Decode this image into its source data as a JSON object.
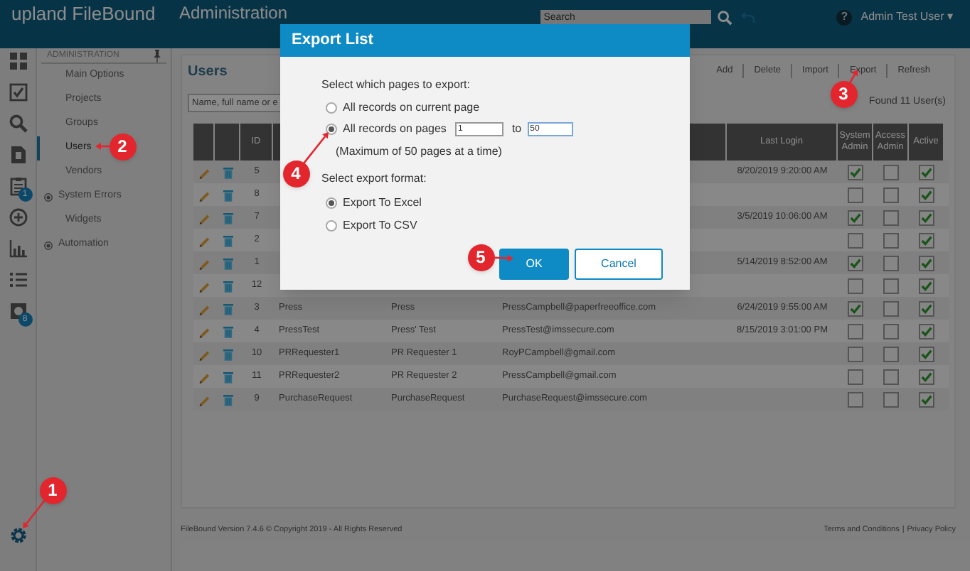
{
  "header": {
    "logo": "upland FileBound",
    "title": "Administration",
    "search": {
      "placeholder": "Search"
    },
    "help": "?",
    "user": "Admin Test User",
    "user_caret": "▾"
  },
  "rail": [
    {
      "kind": "dashboard"
    },
    {
      "kind": "task"
    },
    {
      "kind": "search"
    },
    {
      "kind": "document"
    },
    {
      "kind": "clipboard",
      "badge": "1"
    },
    {
      "kind": "plus"
    },
    {
      "kind": "chart"
    },
    {
      "kind": "list"
    },
    {
      "kind": "box",
      "badge": "8"
    },
    {
      "kind": "settings"
    }
  ],
  "sidebar": {
    "heading": "ADMINISTRATION",
    "items": [
      {
        "label": "Main Options",
        "kind": "item",
        "selected": false
      },
      {
        "label": "Projects",
        "kind": "item",
        "selected": false
      },
      {
        "label": "Groups",
        "kind": "item",
        "selected": false
      },
      {
        "label": "Users",
        "kind": "item",
        "selected": true
      },
      {
        "label": "Vendors",
        "kind": "item",
        "selected": false
      },
      {
        "label": "System Errors",
        "kind": "group",
        "selected": false
      },
      {
        "label": "Widgets",
        "kind": "item",
        "selected": false
      },
      {
        "label": "Automation",
        "kind": "group",
        "selected": false
      }
    ]
  },
  "users": {
    "title": "Users",
    "toolbar": [
      "Add",
      "Delete",
      "Import",
      "Export",
      "Refresh"
    ],
    "search": {
      "placeholder": "Name, full name or e"
    },
    "found": "Found 11 User(s)",
    "columns": [
      {
        "label": "ID"
      },
      {
        "label": "Last Login"
      },
      {
        "label": "System Admin"
      },
      {
        "label": "Access Admin"
      },
      {
        "label": "Active"
      }
    ],
    "rows": [
      {
        "id": "5",
        "last_login": "8/20/2019 9:20:00 AM",
        "system_admin": true,
        "access_admin": false,
        "active": true
      },
      {
        "id": "8",
        "system_admin": false,
        "access_admin": false,
        "active": true
      },
      {
        "id": "7",
        "last_login": "3/5/2019 10:06:00 AM",
        "system_admin": true,
        "access_admin": false,
        "active": true
      },
      {
        "id": "2",
        "system_admin": false,
        "access_admin": false,
        "active": true
      },
      {
        "id": "1",
        "last_login": "5/14/2019 8:52:00 AM",
        "system_admin": true,
        "access_admin": false,
        "active": true
      },
      {
        "id": "12",
        "system_admin": false,
        "access_admin": false,
        "active": true
      },
      {
        "id": "3",
        "username": "Press",
        "full_name": "Press",
        "email": "PressCampbell@paperfreeoffice.com",
        "last_login": "6/24/2019 9:55:00 AM",
        "system_admin": true,
        "access_admin": false,
        "active": true
      },
      {
        "id": "4",
        "username": "PressTest",
        "full_name": "Press' Test",
        "email": "PressTest@imssecure.com",
        "last_login": "8/15/2019 3:01:00 PM",
        "system_admin": false,
        "access_admin": false,
        "active": true
      },
      {
        "id": "10",
        "username": "PRRequester1",
        "full_name": "PR Requester 1",
        "email": "RoyPCampbell@gmail.com",
        "system_admin": false,
        "access_admin": false,
        "active": true
      },
      {
        "id": "11",
        "username": "PRRequester2",
        "full_name": "PR Requester 2",
        "email": "PressCampbell@gmail.com",
        "system_admin": false,
        "access_admin": false,
        "active": true
      },
      {
        "id": "9",
        "username": "PurchaseRequest",
        "full_name": "PurchaseRequest",
        "email": "PurchaseRequest@imssecure.com",
        "system_admin": false,
        "access_admin": false,
        "active": true
      }
    ]
  },
  "footer": {
    "version": "FileBound Version 7.4.6 © Copyright 2019 - All Rights Reserved",
    "links": [
      "Terms and Conditions",
      "Privacy Policy"
    ],
    "separator": "|"
  },
  "modal": {
    "title": "Export List",
    "pages_label": "Select which pages to export:",
    "page_options": [
      {
        "label": "All records on current page",
        "kind": "plain",
        "selected": false
      },
      {
        "label": "All records on pages",
        "kind": "range",
        "selected": true
      }
    ],
    "range_from": "1",
    "range_to_label": "to",
    "range_to": "50",
    "note": "(Maximum of 50 pages at a time)",
    "format_label": "Select export format:",
    "format_options": [
      {
        "label": "Export To Excel",
        "selected": true
      },
      {
        "label": "Export To CSV",
        "selected": false
      }
    ],
    "buttons": [
      {
        "label": "OK",
        "kind": "primary"
      },
      {
        "label": "Cancel",
        "kind": "secondary"
      }
    ]
  },
  "annotations": [
    {
      "label": "1"
    },
    {
      "label": "2"
    },
    {
      "label": "3"
    },
    {
      "label": "4"
    },
    {
      "label": "5"
    }
  ]
}
